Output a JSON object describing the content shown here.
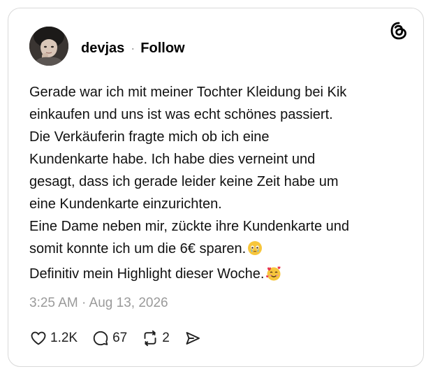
{
  "post": {
    "author": {
      "username": "devjas",
      "separator": "·",
      "follow_label": "Follow"
    },
    "platform_icon": "threads-logo-icon",
    "body_lines": [
      "Gerade war ich mit meiner Tochter Kleidung bei Kik",
      "einkaufen und uns ist was echt schönes passiert.",
      "Die Verkäuferin fragte mich ob ich eine",
      "Kundenkarte habe. Ich habe dies verneint und",
      "gesagt, dass ich gerade leider keine Zeit habe um",
      "eine Kundenkarte einzurichten.",
      "Eine Dame neben mir, zückte ihre Kundenkarte und",
      "somit konnte ich um die 6€ sparen.",
      "Definitiv mein Highlight dieser Woche."
    ],
    "emojis": {
      "line_8": "🥹",
      "line_9": "🥰"
    },
    "timestamp": "3:25 AM · Aug 13, 2026",
    "stats": {
      "likes": "1.2K",
      "replies": "67",
      "reposts": "2"
    },
    "colors": {
      "text": "#111111",
      "muted": "#9a9a9a",
      "border": "#d9d9d9"
    }
  }
}
